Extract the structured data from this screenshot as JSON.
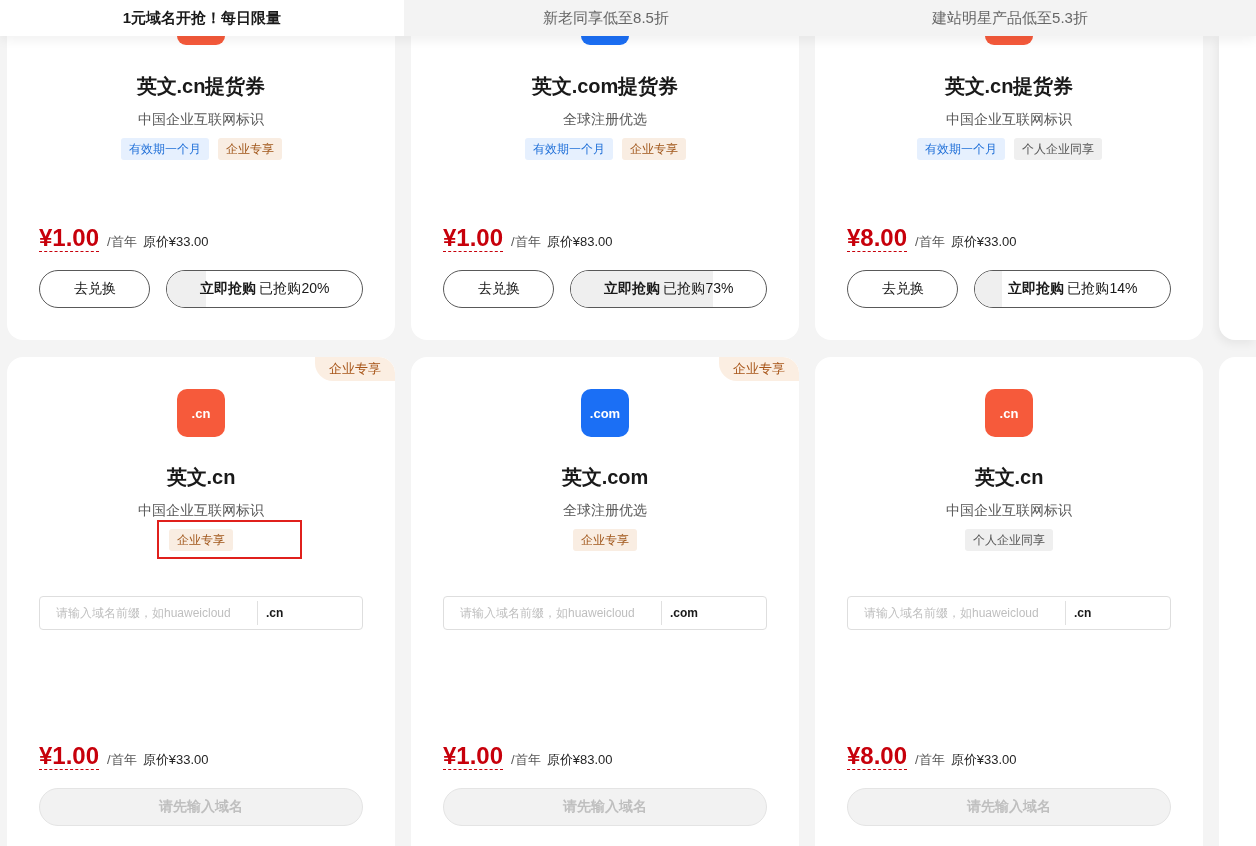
{
  "tabs": [
    {
      "label": "1元域名开抢！每日限量",
      "selected": true
    },
    {
      "label": "新老同享低至8.5折",
      "selected": false
    },
    {
      "label": "建站明星产品低至5.3折",
      "selected": false
    }
  ],
  "voucher_cards": [
    {
      "icon": {
        "color": "#f65a3b"
      },
      "title": "英文.cn提货券",
      "subtitle": "中国企业互联网标识",
      "tags": [
        {
          "label": "有效期一个月",
          "kind": "validity"
        },
        {
          "label": "企业专享",
          "kind": "enterprise"
        }
      ],
      "price": "¥1.00",
      "unit": "/首年",
      "original_price": "原价¥33.00",
      "redeem_button": "去兑换",
      "buy_button": {
        "label": "立即抢购",
        "sold": "已抢购20%",
        "level": 0.2
      }
    },
    {
      "icon": {
        "color": "#1b6ff5"
      },
      "title": "英文.com提货券",
      "subtitle": "全球注册优选",
      "tags": [
        {
          "label": "有效期一个月",
          "kind": "validity"
        },
        {
          "label": "企业专享",
          "kind": "enterprise"
        }
      ],
      "price": "¥1.00",
      "unit": "/首年",
      "original_price": "原价¥83.00",
      "redeem_button": "去兑换",
      "buy_button": {
        "label": "立即抢购",
        "sold": "已抢购73%",
        "level": 0.73
      }
    },
    {
      "icon": {
        "color": "#f65a3b"
      },
      "title": "英文.cn提货券",
      "subtitle": "中国企业互联网标识",
      "tags": [
        {
          "label": "有效期一个月",
          "kind": "validity"
        },
        {
          "label": "个人企业同享",
          "kind": "shared"
        }
      ],
      "price": "¥8.00",
      "unit": "/首年",
      "original_price": "原价¥33.00",
      "redeem_button": "去兑换",
      "buy_button": {
        "label": "立即抢购",
        "sold": "已抢购14%",
        "level": 0.14
      }
    }
  ],
  "domain_cards": [
    {
      "corner_badge": "企业专享",
      "icon": {
        "label": ".cn",
        "color": "#f65a3b"
      },
      "title": "英文.cn",
      "subtitle": "中国企业互联网标识",
      "tags": [
        {
          "label": "企业专享",
          "kind": "enterprise"
        }
      ],
      "highlighted": true,
      "input": {
        "placeholder": "请输入域名前缀，如huaweicloud",
        "suffix": ".cn"
      },
      "price": "¥1.00",
      "unit": "/首年",
      "original_price": "原价¥33.00",
      "button": {
        "label": "请先输入域名",
        "disabled": true
      }
    },
    {
      "corner_badge": "企业专享",
      "icon": {
        "label": ".com",
        "color": "#1b6ff5"
      },
      "title": "英文.com",
      "subtitle": "全球注册优选",
      "tags": [
        {
          "label": "企业专享",
          "kind": "enterprise"
        }
      ],
      "highlighted": false,
      "input": {
        "placeholder": "请输入域名前缀，如huaweicloud",
        "suffix": ".com"
      },
      "price": "¥1.00",
      "unit": "/首年",
      "original_price": "原价¥83.00",
      "button": {
        "label": "请先输入域名",
        "disabled": true
      }
    },
    {
      "icon": {
        "label": ".cn",
        "color": "#f65a3b"
      },
      "title": "英文.cn",
      "subtitle": "中国企业互联网标识",
      "tags": [
        {
          "label": "个人企业同享",
          "kind": "shared"
        }
      ],
      "highlighted": false,
      "input": {
        "placeholder": "请输入域名前缀，如huaweicloud",
        "suffix": ".cn"
      },
      "price": "¥8.00",
      "unit": "/首年",
      "original_price": "原价¥33.00",
      "button": {
        "label": "请先输入域名",
        "disabled": true
      }
    }
  ]
}
